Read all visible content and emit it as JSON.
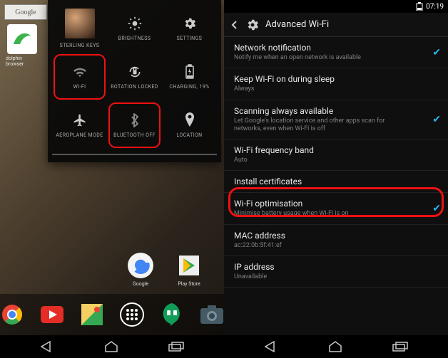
{
  "left": {
    "search_label": "Google",
    "app_shortcut": {
      "label": "dolphin browser"
    },
    "user_tile": "STERLING KEYS",
    "tiles": {
      "brightness": "BRIGHTNESS",
      "settings": "SETTINGS",
      "wifi": "WI-FI",
      "rotation": "ROTATION LOCKED",
      "charging": "CHARGING, 19%",
      "aeroplane": "AEROPLANE MODE",
      "bluetooth": "BLUETOOTH OFF",
      "location": "LOCATION"
    },
    "home_shortcuts": {
      "google": "Google",
      "play": "Play Store"
    }
  },
  "right": {
    "time": "07:19",
    "header": "Advanced Wi-Fi",
    "items": {
      "net_notif": {
        "title": "Network notification",
        "sub": "Notify me when an open network is available",
        "checked": true
      },
      "keep_on": {
        "title": "Keep Wi-Fi on during sleep",
        "sub": "Always"
      },
      "scan": {
        "title": "Scanning always available",
        "sub": "Let Google's location service and other apps scan for networks, even when Wi-Fi is off",
        "checked": true
      },
      "freq": {
        "title": "Wi-Fi frequency band",
        "sub": "Auto"
      },
      "install": {
        "title": "Install certificates"
      },
      "optim": {
        "title": "Wi-Fi optimisation",
        "sub": "Minimise battery usage when Wi-Fi is on",
        "checked": true
      },
      "mac": {
        "title": "MAC address",
        "sub": "ac:22:0b:5f:41:ef"
      },
      "ip": {
        "title": "IP address",
        "sub": "Unavailable"
      }
    }
  }
}
